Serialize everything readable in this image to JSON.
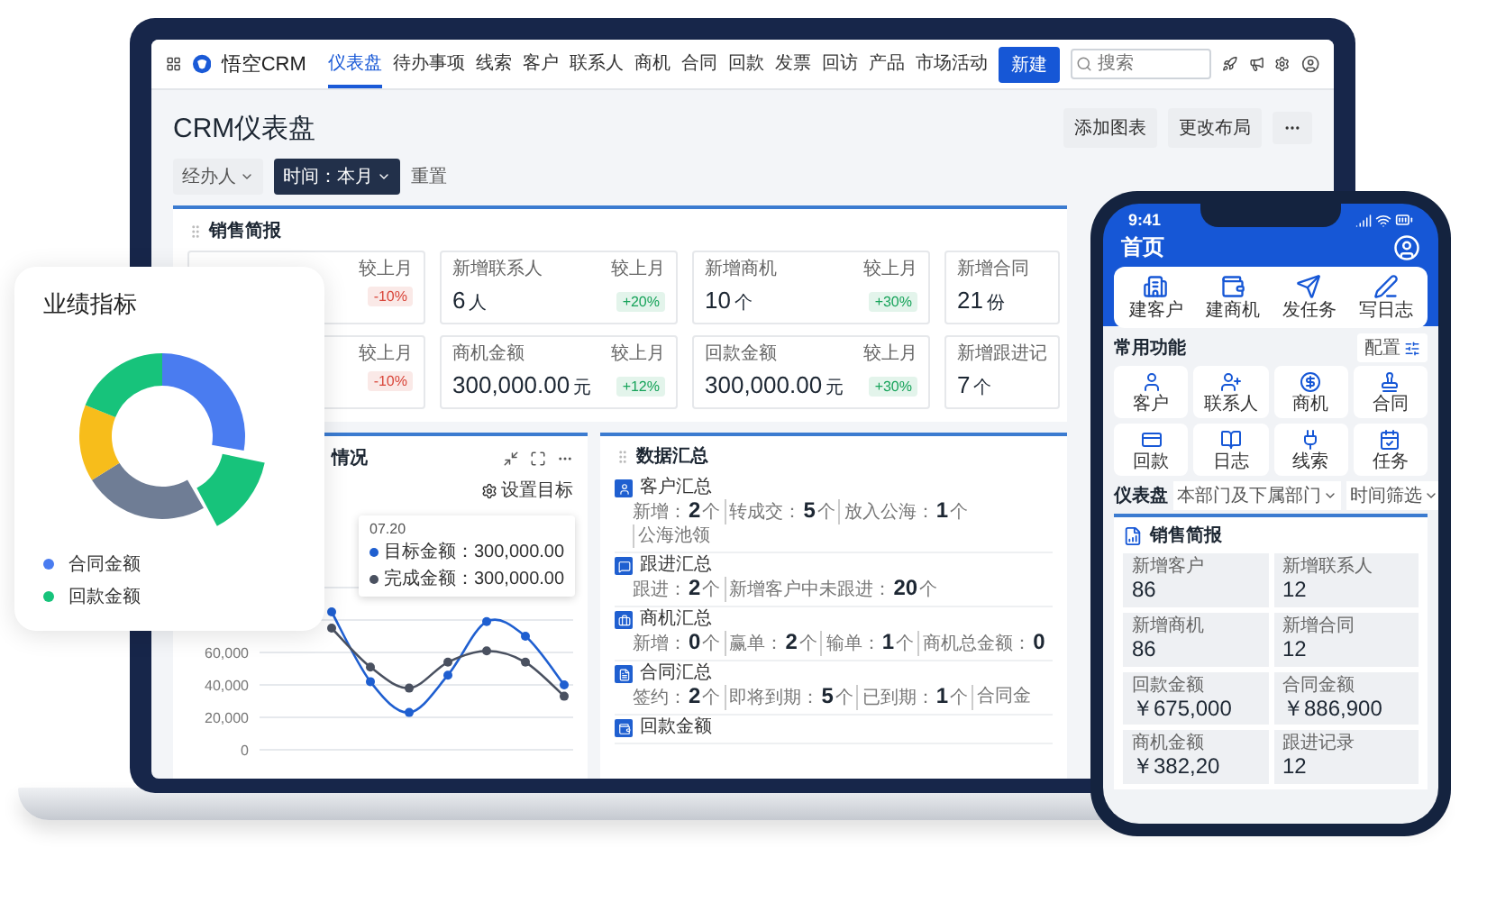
{
  "laptop": {
    "nav": {
      "brand": "悟空CRM",
      "tabs": [
        {
          "label": "仪表盘",
          "selected": true
        },
        {
          "label": "待办事项",
          "selected": false
        },
        {
          "label": "线索",
          "selected": false
        },
        {
          "label": "客户",
          "selected": false
        },
        {
          "label": "联系人",
          "selected": false
        },
        {
          "label": "商机",
          "selected": false
        },
        {
          "label": "合同",
          "selected": false
        },
        {
          "label": "回款",
          "selected": false
        },
        {
          "label": "发票",
          "selected": false
        },
        {
          "label": "回访",
          "selected": false
        },
        {
          "label": "产品",
          "selected": false
        },
        {
          "label": "市场活动",
          "selected": false
        }
      ],
      "new_button": "新建",
      "search": {
        "placeholder": "搜索"
      }
    },
    "page_title": "CRM仪表盘",
    "header_buttons": [
      "添加图表",
      "更改布局"
    ],
    "filters": [
      {
        "label": "经办人",
        "active": false
      },
      {
        "label": "时间：本月",
        "active": true
      }
    ],
    "reset": "重置",
    "sales_report": {
      "title": "销售简报",
      "cards": [
        {
          "compare": "较上月",
          "change": "-10%",
          "color": "#d9463a"
        },
        {
          "label": "新增联系人",
          "value": "6",
          "unit": "人",
          "compare": "较上月",
          "change": "+20%",
          "color": "#17a35a"
        },
        {
          "label": "新增商机",
          "value": "10",
          "unit": "个",
          "compare": "较上月",
          "change": "+30%",
          "color": "#17a35a"
        },
        {
          "label": "新增合同",
          "value": "21",
          "unit": "份"
        },
        {
          "compare": "较上月",
          "change": "-10%",
          "color": "#d9463a"
        },
        {
          "label": "商机金额",
          "value": "300,000.00",
          "unit": "元",
          "compare": "较上月",
          "change": "+12%",
          "color": "#17a35a"
        },
        {
          "label": "回款金额",
          "value": "300,000.00",
          "unit": "元",
          "compare": "较上月",
          "change": "+30%",
          "color": "#17a35a"
        },
        {
          "label": "新增跟进记",
          "value": "7",
          "unit": "个"
        }
      ]
    },
    "trend_panel": {
      "title": "情况",
      "goal_button": "设置目标",
      "chart_data": {
        "type": "line",
        "grid": true,
        "ylim": [
          0,
          100000
        ],
        "legend": true,
        "yticks": [
          {
            "value": 0,
            "label": "0"
          },
          {
            "value": 20000,
            "label": "20,000"
          },
          {
            "value": 40000,
            "label": "40,000"
          },
          {
            "value": 60000,
            "label": "60,000"
          }
        ],
        "series": [
          {
            "name": "目标金额",
            "color": "#1f5fd0",
            "marker": "circle",
            "values": [
              85000,
              42000,
              23000,
              46000,
              79000,
              70000,
              40000
            ]
          },
          {
            "name": "完成金额",
            "color": "#4a5160",
            "marker": "circle",
            "values": [
              75000,
              51000,
              38000,
              54000,
              61000,
              54000,
              33000
            ]
          }
        ]
      },
      "tooltip": {
        "title": "07.20",
        "values": [
          "：300,000.00",
          "：300,000.00"
        ]
      }
    },
    "summary": {
      "title": "数据汇总",
      "sections": [
        {
          "title": "客户汇总",
          "stats": [
            {
              "label": "新增：",
              "value": "2",
              "unit": "个"
            },
            {
              "label": "转成交：",
              "value": "5",
              "unit": "个"
            },
            {
              "label": "放入公海：",
              "value": "1",
              "unit": "个"
            },
            {
              "label": "公海池领"
            }
          ]
        },
        {
          "title": "跟进汇总",
          "stats": [
            {
              "label": "跟进：",
              "value": "2",
              "unit": "个"
            },
            {
              "label": "新增客户中未跟进：",
              "value": "20",
              "unit": "个"
            }
          ]
        },
        {
          "title": "商机汇总",
          "stats": [
            {
              "label": "新增：",
              "value": "0",
              "unit": "个"
            },
            {
              "label": "赢单：",
              "value": "2",
              "unit": "个"
            },
            {
              "label": "输单：",
              "value": "1",
              "unit": "个"
            },
            {
              "label": "商机总金额：",
              "value": "0"
            }
          ]
        },
        {
          "title": "合同汇总",
          "stats": [
            {
              "label": "签约：",
              "value": "2",
              "unit": "个"
            },
            {
              "label": "即将到期：",
              "value": "5",
              "unit": "个"
            },
            {
              "label": "已到期：",
              "value": "1",
              "unit": "个"
            },
            {
              "label": "合同金"
            }
          ]
        },
        {
          "title": "回款金额"
        }
      ]
    }
  },
  "phone": {
    "time": "9:41",
    "title": "首页",
    "quick_actions": [
      "建客户",
      "建商机",
      "发任务",
      "写日志"
    ],
    "functions_title": "常用功能",
    "configure_button": "配置",
    "functions": [
      "客户",
      "联系人",
      "商机",
      "合同",
      "回款",
      "日志",
      "线索",
      "任务"
    ],
    "dashboard": {
      "title": "仪表盘",
      "filters": [
        "本部门及下属部门",
        "时间筛选"
      ]
    },
    "report": {
      "title": "销售简报",
      "items": [
        {
          "label": "新增客户",
          "value": "86"
        },
        {
          "label": "新增联系人",
          "value": "12"
        },
        {
          "label": "新增商机",
          "value": "86"
        },
        {
          "label": "新增合同",
          "value": "12"
        },
        {
          "label": "回款金额",
          "value": "￥675,000"
        },
        {
          "label": "合同金额",
          "value": "￥886,900"
        },
        {
          "label": "商机金额",
          "value": "￥382,20"
        },
        {
          "label": "跟进记录",
          "value": "12"
        }
      ]
    }
  },
  "performance_card": {
    "title": "业绩指标",
    "legend": [
      {
        "label": "合同金额",
        "color": "#4a7cf0"
      },
      {
        "label": "回款金额",
        "color": "#17c37b"
      }
    ]
  }
}
